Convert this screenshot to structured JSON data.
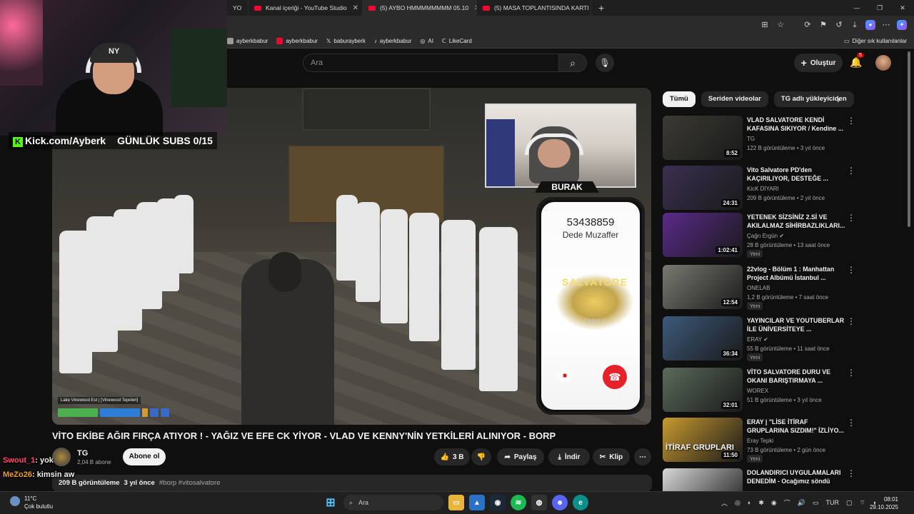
{
  "tabs": [
    {
      "label": "YO"
    },
    {
      "label": "Kanal içeriği - YouTube Studio"
    },
    {
      "label": "(5) AYBO HMMMMMMMM 05.10"
    },
    {
      "label": "(5) MASA TOPLANTISINDA KARTI"
    }
  ],
  "bookmarks": [
    {
      "label": "ayberkbabur",
      "color": "#9a9a9a"
    },
    {
      "label": "ayberkbabur",
      "color": "#ff0033"
    },
    {
      "label": "baburayberk",
      "color": "#e6e6e6"
    },
    {
      "label": "ayberkbabur",
      "color": "#e6e6e6"
    },
    {
      "label": "AI",
      "color": "#bbbbbb"
    },
    {
      "label": "LikeCard",
      "color": "#f5f5f5"
    }
  ],
  "bookmarks_other": "Diğer sık kullanılanlar",
  "search": {
    "placeholder": "Ara"
  },
  "header": {
    "create_label": "Oluştur",
    "notif_count": "5"
  },
  "overlay": {
    "kick_label": "Kick.com/Ayberk",
    "subs_label": "GÜNLÜK SUBS 0/15",
    "cap_text": "NY",
    "cam2_name": "BURAK"
  },
  "phone": {
    "number": "53438859",
    "name": "Dede Muzaffer",
    "logo_text": "SALVATORE",
    "logo_sub": "FAMILY",
    "dots": ". . ."
  },
  "hud": {
    "location": "Lake Vinewood Est | [Vinewood Tepeleri]"
  },
  "video": {
    "title": "VİTO EKİBE AĞIR FIRÇA ATIYOR ! - YAĞIZ VE EFE CK YİYOR - VLAD VE KENNY'NİN YETKİLERİ ALINIYOR - BORP",
    "channel": "TG",
    "subscribers": "2,04 B abone",
    "subscribe_label": "Abone ol",
    "likes": "3 B",
    "share_label": "Paylaş",
    "download_label": "İndir",
    "clip_label": "Klip",
    "views": "209 B görüntüleme",
    "age": "3 yıl önce",
    "tags": "#borp #vitosalvatore"
  },
  "chat": [
    {
      "user": "Swout_1",
      "text": ": yok",
      "color": "#ff4d6a"
    },
    {
      "user": "MeZo26",
      "text": ": kimsin aw",
      "color": "#f0a020"
    }
  ],
  "chips": [
    "Tümü",
    "Seriden videolar",
    "TG adlı yükleyiciden"
  ],
  "recommendations": [
    {
      "title": "VLAD SALVATORE KENDİ KAFASINA SIKIYOR / Kendine ...",
      "channel": "TG",
      "meta": "122 B görüntüleme • 3 yıl önce",
      "duration": "8:52",
      "badge": "",
      "thumb": "#3b3a33"
    },
    {
      "title": "Vito Salvatore PD'den KAÇIRILIYOR, DESTEĞE ...",
      "channel": "KicK DİYARI",
      "meta": "209 B görüntüleme • 2 yıl önce",
      "duration": "24:31",
      "badge": "",
      "thumb": "#3a3050"
    },
    {
      "title": "YETENEK SİZSİNİZ 2.Sİ VE AKILALMAZ SİHİRBAZLIKLARI...",
      "channel": "Çağrı Ergün ✔",
      "meta": "28 B görüntüleme • 13 saat önce",
      "duration": "1:02:41",
      "badge": "Yeni",
      "thumb": "#5a2a8a"
    },
    {
      "title": "22vlog - Bölüm 1 : Manhattan Project Albümü İstanbul ...",
      "channel": "ONELAB",
      "meta": "1,2 B görüntüleme • 7 saat önce",
      "duration": "12:54",
      "badge": "Yeni",
      "thumb": "#7a7a72"
    },
    {
      "title": "YAYINCILAR VE YOUTUBERLAR İLE ÜNİVERSİTEYE ...",
      "channel": "ERAY ✔",
      "meta": "55 B görüntüleme • 11 saat önce",
      "duration": "36:34",
      "badge": "Yeni",
      "thumb": "#3c5a7a"
    },
    {
      "title": "VİTO SALVATORE DURU VE OKANI BARIŞTIRMAYA ...",
      "channel": "WOREX",
      "meta": "51 B görüntüleme • 3 yıl önce",
      "duration": "32:01",
      "badge": "",
      "thumb": "#5a6a5a"
    },
    {
      "title": "ERAY | \"LİSE İTİRAF GRUPLARINA SIZDIM!\" İZLİYO...",
      "channel": "Eray Tepki",
      "meta": "73 B görüntüleme • 2 gün önce",
      "duration": "11:50",
      "badge": "Yeni",
      "thumb": "#c89a30",
      "thumb_text": "İTİRAF GRUPLARI"
    },
    {
      "title": "DOLANDIRICI UYGULAMALARI DENEDİM - Ocağımız söndü",
      "channel": "",
      "meta": "",
      "duration": "",
      "badge": "",
      "thumb": "#d8d8d8"
    }
  ],
  "taskbar": {
    "weather_temp": "11°C",
    "weather_desc": "Çok bulutlu",
    "search_label": "Ara",
    "lang": "TUR",
    "time": "08:01",
    "date": "29.10.2025"
  }
}
